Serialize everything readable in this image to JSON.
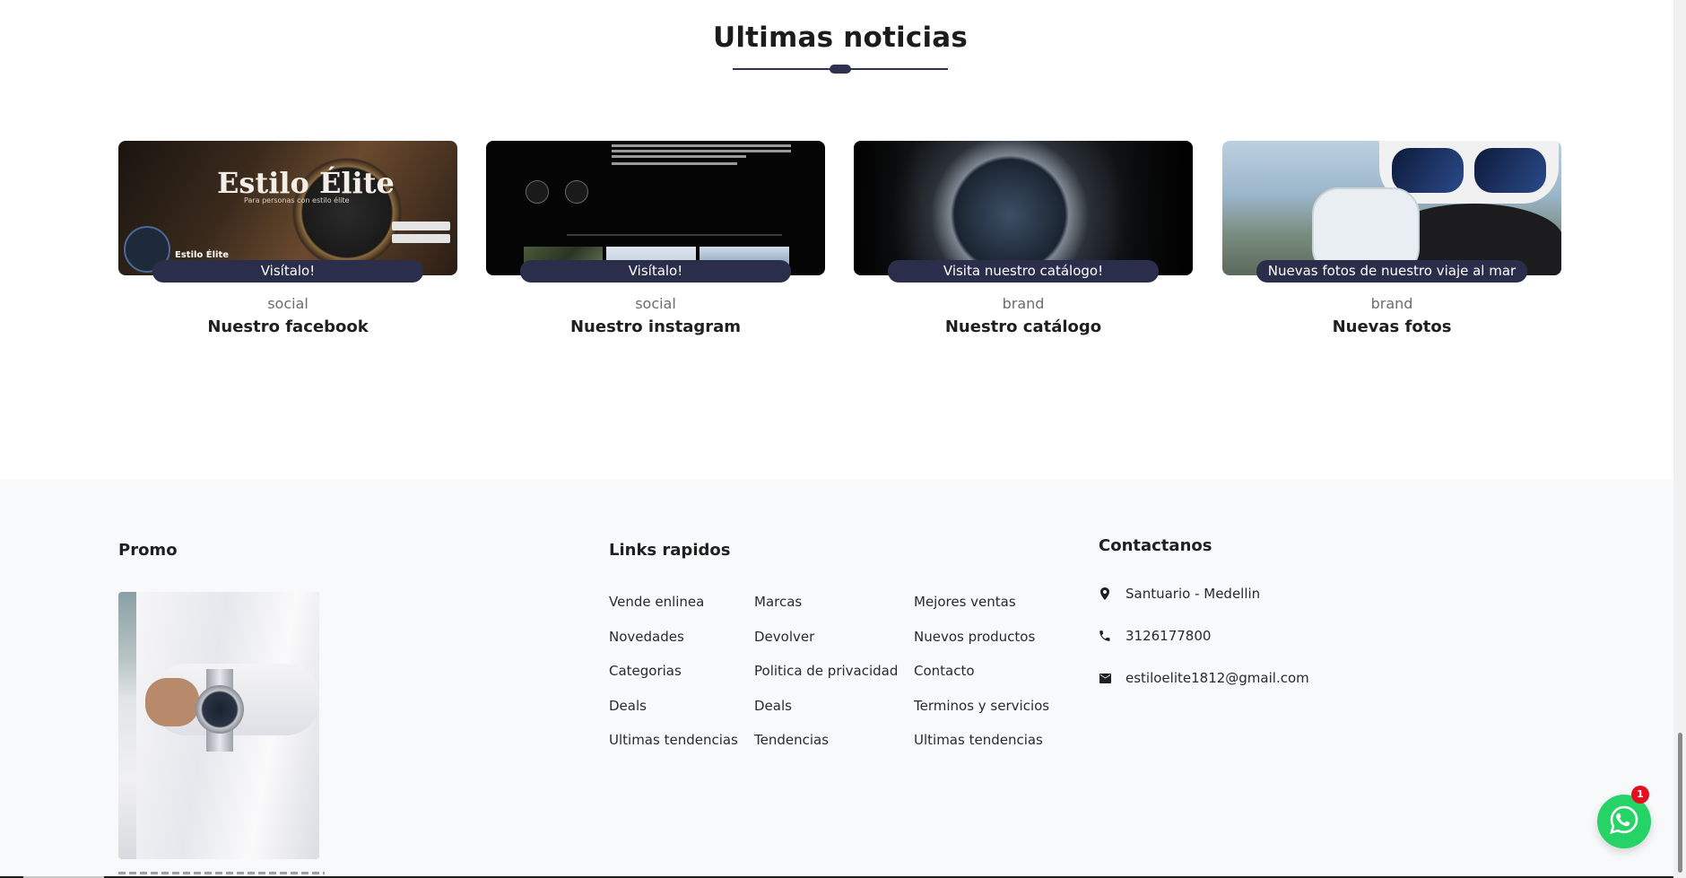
{
  "news": {
    "title": "Ultimas noticias",
    "cards": [
      {
        "badge": "Visítalo!",
        "category": "social",
        "title": "Nuestro facebook",
        "image": {
          "brand_text": "Estilo Élite",
          "brand_sub": "Para personas con estilo élite",
          "profile_name": "Estilo Élite"
        }
      },
      {
        "badge": "Visítalo!",
        "category": "social",
        "title": "Nuestro instagram"
      },
      {
        "badge": "Visita nuestro catálogo!",
        "category": "brand",
        "title": "Nuestro catálogo"
      },
      {
        "badge": "Nuevas fotos de nuestro viaje al mar",
        "category": "brand",
        "title": "Nuevas fotos"
      }
    ]
  },
  "footer": {
    "promo": {
      "heading": "Promo"
    },
    "links": {
      "heading": "Links rapidos",
      "col1": [
        "Vende enlinea",
        "Novedades",
        "Categorias",
        "Deals",
        "Ultimas tendencias"
      ],
      "col2": [
        "Marcas",
        "Devolver",
        "Politica de privacidad",
        "Deals",
        "Tendencias"
      ],
      "col3": [
        "Mejores ventas",
        "Nuevos productos",
        "Contacto",
        "Terminos y servicios",
        "Ultimas tendencias"
      ]
    },
    "contact": {
      "heading": "Contactanos",
      "address": "Santuario - Medellin",
      "phone": "3126177800",
      "email": "estiloelite1812@gmail.com"
    }
  },
  "whatsapp": {
    "badge_count": "1",
    "color": "#25d366"
  },
  "colors": {
    "accent": "#2b2e4a",
    "footer_bg": "#f8f9fb"
  }
}
